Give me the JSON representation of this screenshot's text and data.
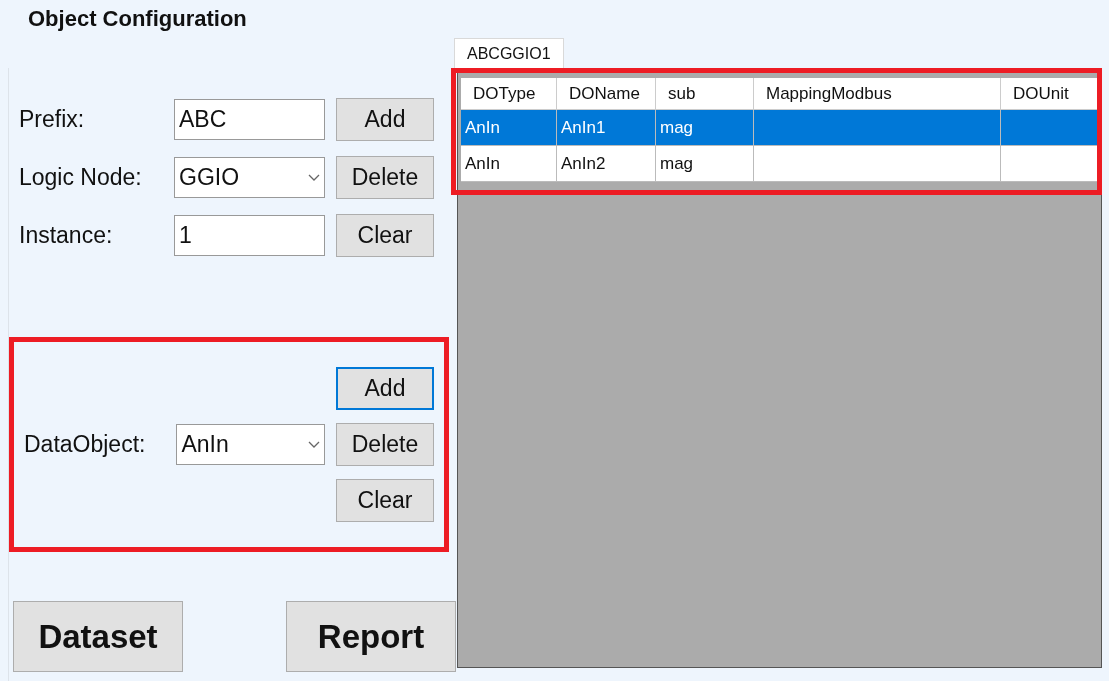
{
  "title": "Object Configuration",
  "fields": [
    {
      "kind": "text",
      "label": "Prefix:",
      "value": "ABC",
      "button": "Add"
    },
    {
      "kind": "combo",
      "label": "Logic Node:",
      "value": "GGIO",
      "button": "Delete"
    },
    {
      "kind": "text",
      "label": "Instance:",
      "value": "1",
      "button": "Clear"
    }
  ],
  "data_object": {
    "highlighted": true,
    "label": "DataObject:",
    "value": "AnIn",
    "buttons": [
      {
        "label": "Add",
        "focused": true
      },
      {
        "label": "Delete",
        "focused": false
      },
      {
        "label": "Clear",
        "focused": false
      }
    ]
  },
  "bottom_buttons": [
    "Dataset",
    "Report"
  ],
  "tabs": [
    {
      "label": "ABCGGIO1",
      "selected": true
    }
  ],
  "table": {
    "highlighted": true,
    "columns": [
      "DOType",
      "DOName",
      "sub",
      "MappingModbus",
      "DOUnit"
    ],
    "rows": [
      {
        "selected": true,
        "cells": [
          "AnIn",
          "AnIn1",
          "mag"
        ]
      },
      {
        "selected": false,
        "cells": [
          "AnIn",
          "AnIn2",
          "mag"
        ]
      }
    ]
  }
}
